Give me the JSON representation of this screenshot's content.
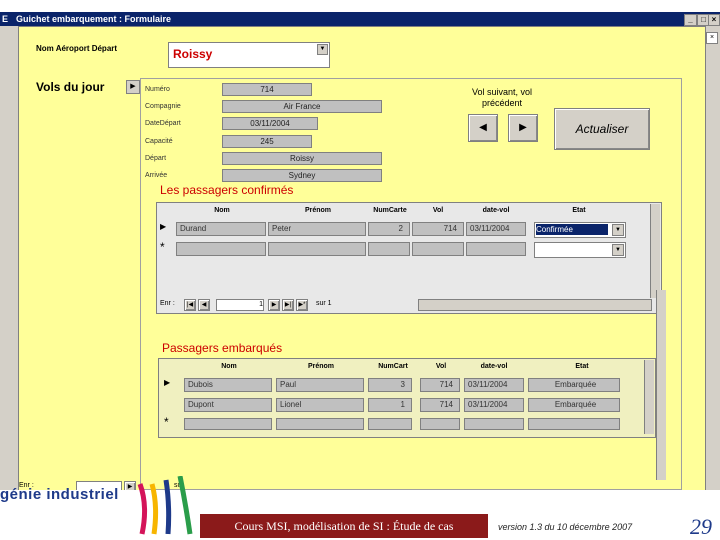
{
  "window": {
    "title": "Guichet embarquement : Formulaire",
    "icon_text": "E"
  },
  "header": {
    "airport_label": "Nom Aéroport Départ",
    "airport_value": "Roissy"
  },
  "section": {
    "title": "Vols du jour"
  },
  "flight": {
    "labels": [
      "Numéro",
      "Compagnie",
      "DateDépart",
      "Capacité",
      "Départ",
      "Arrivée"
    ],
    "values": [
      "714",
      "Air France",
      "03/11/2004",
      "245",
      "Roissy",
      "Sydney"
    ]
  },
  "nav": {
    "caption": "Vol suivant, vol précédent",
    "prev_symbol": "◀",
    "next_symbol": "▶",
    "refresh_label": "Actualiser"
  },
  "confirmed": {
    "title": "Les passagers confirmés",
    "columns": [
      "Nom",
      "Prénom",
      "NumCarte",
      "Vol",
      "date-vol",
      "Etat"
    ],
    "rows": [
      [
        "Durand",
        "Peter",
        "2",
        "714",
        "03/11/2004",
        "Confirmée"
      ]
    ],
    "record_label": "Enr :",
    "record_value": "1",
    "record_of": "sur 1"
  },
  "boarded": {
    "title": "Passagers embarqués",
    "columns": [
      "Nom",
      "Prénom",
      "NumCart",
      "Vol",
      "date-vol",
      "Etat"
    ],
    "rows": [
      [
        "Dubois",
        "Paul",
        "3",
        "714",
        "03/11/2004",
        "Embarquée"
      ],
      [
        "Dupont",
        "Lionel",
        "1",
        "714",
        "03/11/2004",
        "Embarquée"
      ]
    ]
  },
  "outer_nav": {
    "label": "Enr :",
    "of": "sur"
  },
  "footer": {
    "logo": "génie industriel",
    "course": "Cours MSI, modélisation de SI : Étude de cas",
    "version": "version 1.3 du 10 décembre 2007",
    "page": "29"
  },
  "colors": {
    "form_bg": "#ffff99",
    "titlebar": "#0a246a",
    "dark_red": "#8b1a1a",
    "logo_blue": "#1e3a8a"
  }
}
